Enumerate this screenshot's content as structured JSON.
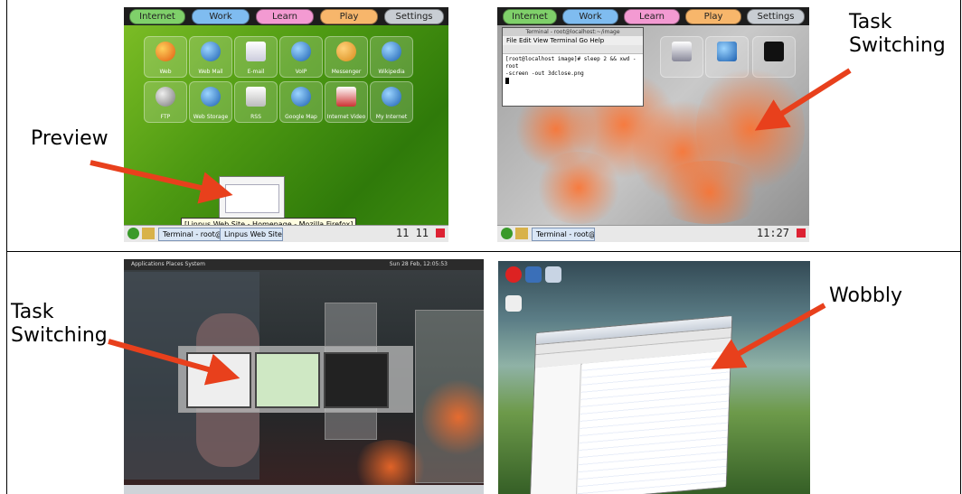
{
  "labels": {
    "preview": "Preview",
    "task_switching_top_line1": "Task",
    "task_switching_top_line2": "Switching",
    "task_switching_bottom_line1": "Task",
    "task_switching_bottom_line2": "Switching",
    "wobbly": "Wobbly"
  },
  "screen1": {
    "tabs": [
      "Internet",
      "Work",
      "Learn",
      "Play",
      "Settings"
    ],
    "icons_row1": [
      "Web",
      "Web Mail",
      "E-mail",
      "VoIP",
      "Messenger",
      "Wikipedia"
    ],
    "icons_row2": [
      "FTP",
      "Web Storage",
      "RSS",
      "Google Map",
      "Internet Video",
      "My Internet"
    ],
    "tooltip": "[Linpus Web Site - Homepage - Mozilla Firefox]",
    "taskbar_item_1": "Terminal - root@l...",
    "taskbar_item_2": "Linpus Web Site",
    "clock": "11 11"
  },
  "screen2": {
    "tabs": [
      "Internet",
      "Work",
      "Learn",
      "Play",
      "Settings"
    ],
    "terminal_title": "Terminal - root@localhost:~/image",
    "terminal_menu": "File  Edit  View  Terminal  Go  Help",
    "terminal_line1": "[root@localhost image]# sleep 2 && xwd -root",
    "terminal_line2": "-screen -out 3dclose.png",
    "taskbar_item_1": "Terminal - root@l...",
    "clock": "11:27"
  },
  "screen3": {
    "topbar": "Applications  Places  System",
    "topbar_right": "Sun 28 Feb, 12:05:53"
  },
  "colors": {
    "arrow": "#e8401c",
    "tab_internet": "#7fd06a",
    "tab_work": "#7fbcf0",
    "tab_learn": "#f39ad2",
    "tab_play": "#f7b66b",
    "tab_settings": "#c8cdd3"
  }
}
